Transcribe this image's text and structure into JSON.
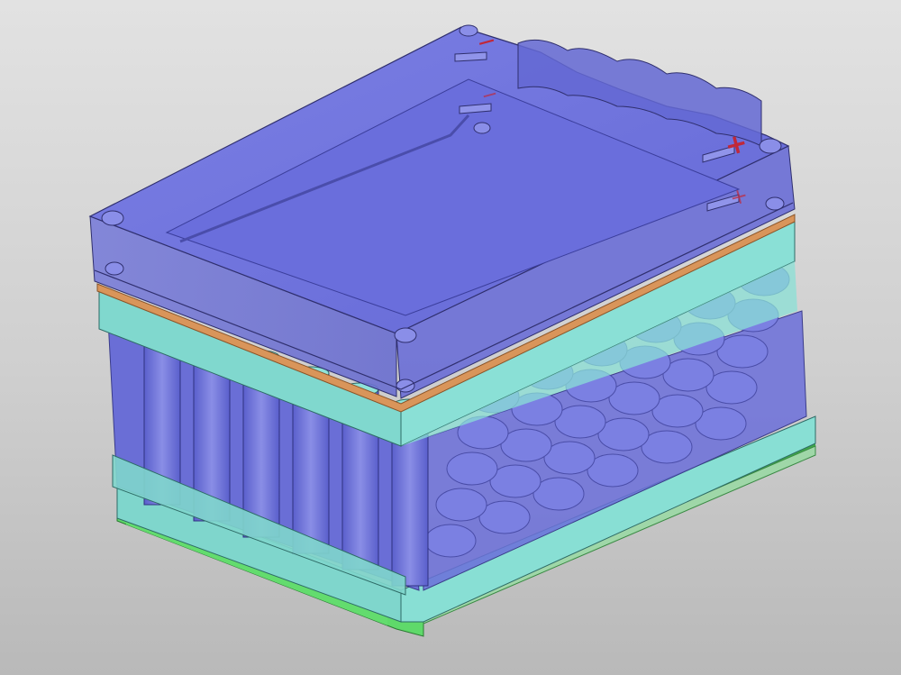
{
  "scene": {
    "description_visible_text": "",
    "background_colors": {
      "top": "#e2e2e2",
      "bottom": "#b9b9b9"
    },
    "colors": {
      "lid_fill": "#5b5fcf",
      "lid_edge": "#2f2f6e",
      "cell_holder_fill": "#7fd6cc",
      "gasket_strip": "#d9955a",
      "base_plate": "#5fd96a",
      "cells_fill": "#6a6fd8",
      "polarity_mark": "#c0283a"
    },
    "markings": {
      "negative_terminal": "−",
      "positive_terminal": "+"
    },
    "parts": [
      {
        "name": "lid",
        "icon": "transparent-lid"
      },
      {
        "name": "gasket",
        "icon": "orange-gasket-strip"
      },
      {
        "name": "upper-cell-holder",
        "icon": "teal-holder"
      },
      {
        "name": "battery-cells",
        "icon": "cylindrical-cells"
      },
      {
        "name": "lower-cell-holder",
        "icon": "teal-holder"
      },
      {
        "name": "base-plate",
        "icon": "green-base"
      }
    ]
  }
}
